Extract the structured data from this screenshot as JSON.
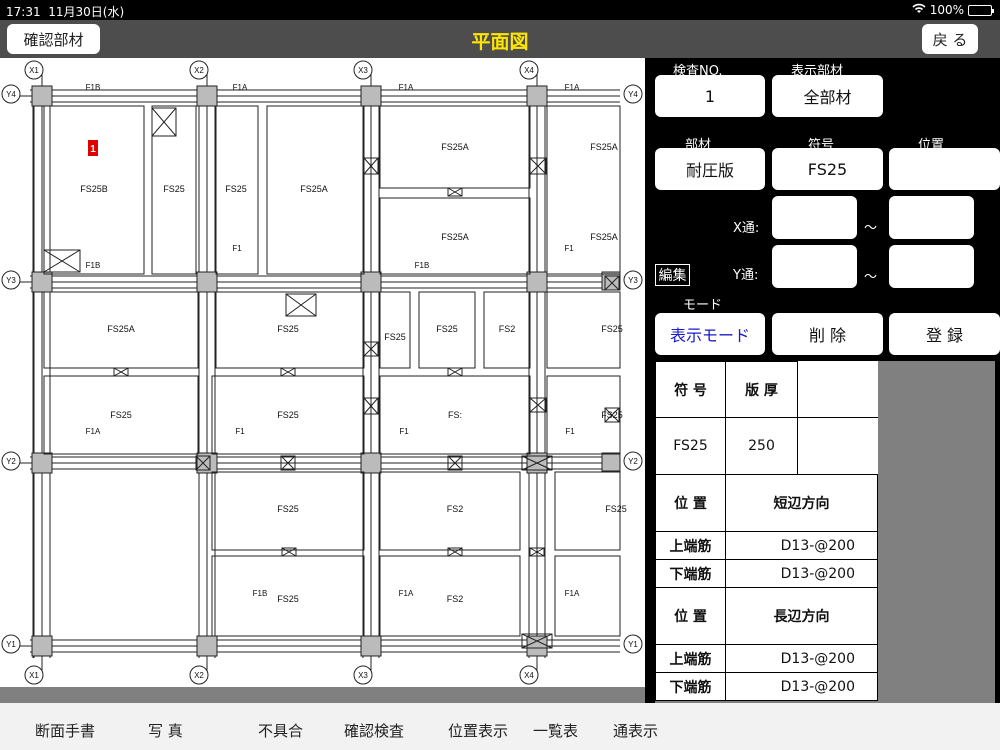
{
  "status": {
    "time": "17:31",
    "date": "11月30日(水)",
    "battery": "100%"
  },
  "nav": {
    "title": "平面図",
    "left_button": "確認部材",
    "right_button": "戻 る"
  },
  "drawing": {
    "axes_x": [
      "X1",
      "X2",
      "X3",
      "X4"
    ],
    "axes_y": [
      "Y4",
      "Y3",
      "Y2",
      "Y1"
    ],
    "beam_labels": [
      "F1B",
      "F1A",
      "F1A",
      "F1A",
      "F1B",
      "F1B",
      "F1",
      "F1",
      "F1A",
      "F1",
      "F1",
      "F1",
      "F1B",
      "F1A",
      "F1A"
    ],
    "slab_labels": [
      "FS25B",
      "FS25",
      "FS25",
      "FS25A",
      "FS25A",
      "FS25A",
      "FS25A",
      "FS25A",
      "FS25A",
      "FS25",
      "FS25",
      "FS25",
      "FS2",
      "FS25",
      "FS25",
      "FS25",
      "FS:",
      "FS25",
      "FS25",
      "FS2",
      "FS25",
      "FS25",
      "FS2"
    ],
    "marker": "1"
  },
  "panel": {
    "inspection_no_label": "検査NO.",
    "inspection_no": "1",
    "display_member_label": "表示部材",
    "display_member": "全部材",
    "member_label": "部材",
    "member": "耐圧版",
    "symbol_label": "符号",
    "symbol": "FS25",
    "position_label": "位置",
    "position": "",
    "x_label": "X通:",
    "y_label": "Y通:",
    "tilde": "〜",
    "edit_label": "編集",
    "mode_label": "モード",
    "mode_display": "表示モード",
    "delete": "削 除",
    "register": "登 録"
  },
  "spec": {
    "symbol_h": "符 号",
    "thickness_h": "版 厚",
    "symbol": "FS25",
    "thickness": "250",
    "pos_h": "位 置",
    "short_dir": "短辺方向",
    "long_dir": "長辺方向",
    "top_bar": "上端筋",
    "bottom_bar": "下端筋",
    "short_top": "D13-@200",
    "short_bottom": "D13-@200",
    "long_top": "D13-@200",
    "long_bottom": "D13-@200"
  },
  "toolbar": {
    "items": [
      "断面手書",
      "写 真",
      "不具合",
      "確認検査",
      "位置表示",
      "一覧表",
      "通表示"
    ]
  },
  "colors": {
    "title": "#ffe600",
    "accent": "#1a1acc",
    "marker": "#e00000"
  }
}
